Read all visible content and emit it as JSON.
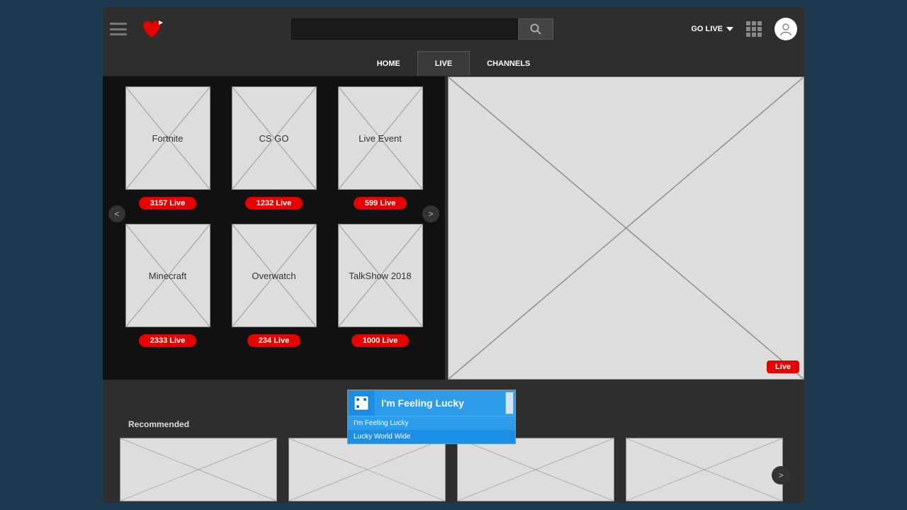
{
  "header": {
    "go_live": "GO LIVE"
  },
  "nav": {
    "home": "HOME",
    "live": "LIVE",
    "channels": "CHANNELS"
  },
  "categories": {
    "prev": "<",
    "next": ">",
    "items": [
      {
        "title": "Fortnite",
        "count": "3157 Live"
      },
      {
        "title": "CS GO",
        "count": "1232 Live"
      },
      {
        "title": "Live Event",
        "count": "599 Live"
      },
      {
        "title": "Minecraft",
        "count": "2333 Live"
      },
      {
        "title": "Overwatch",
        "count": "234 Live"
      },
      {
        "title": "TalkShow 2018",
        "count": "1000 Live"
      }
    ]
  },
  "preview": {
    "live_badge": "Live"
  },
  "lucky": {
    "selected": "I'm Feeling Lucky",
    "options": [
      "I'm Feeling Lucky",
      "Lucky World Wide"
    ]
  },
  "recommended": {
    "title": "Recommended",
    "next": ">"
  }
}
